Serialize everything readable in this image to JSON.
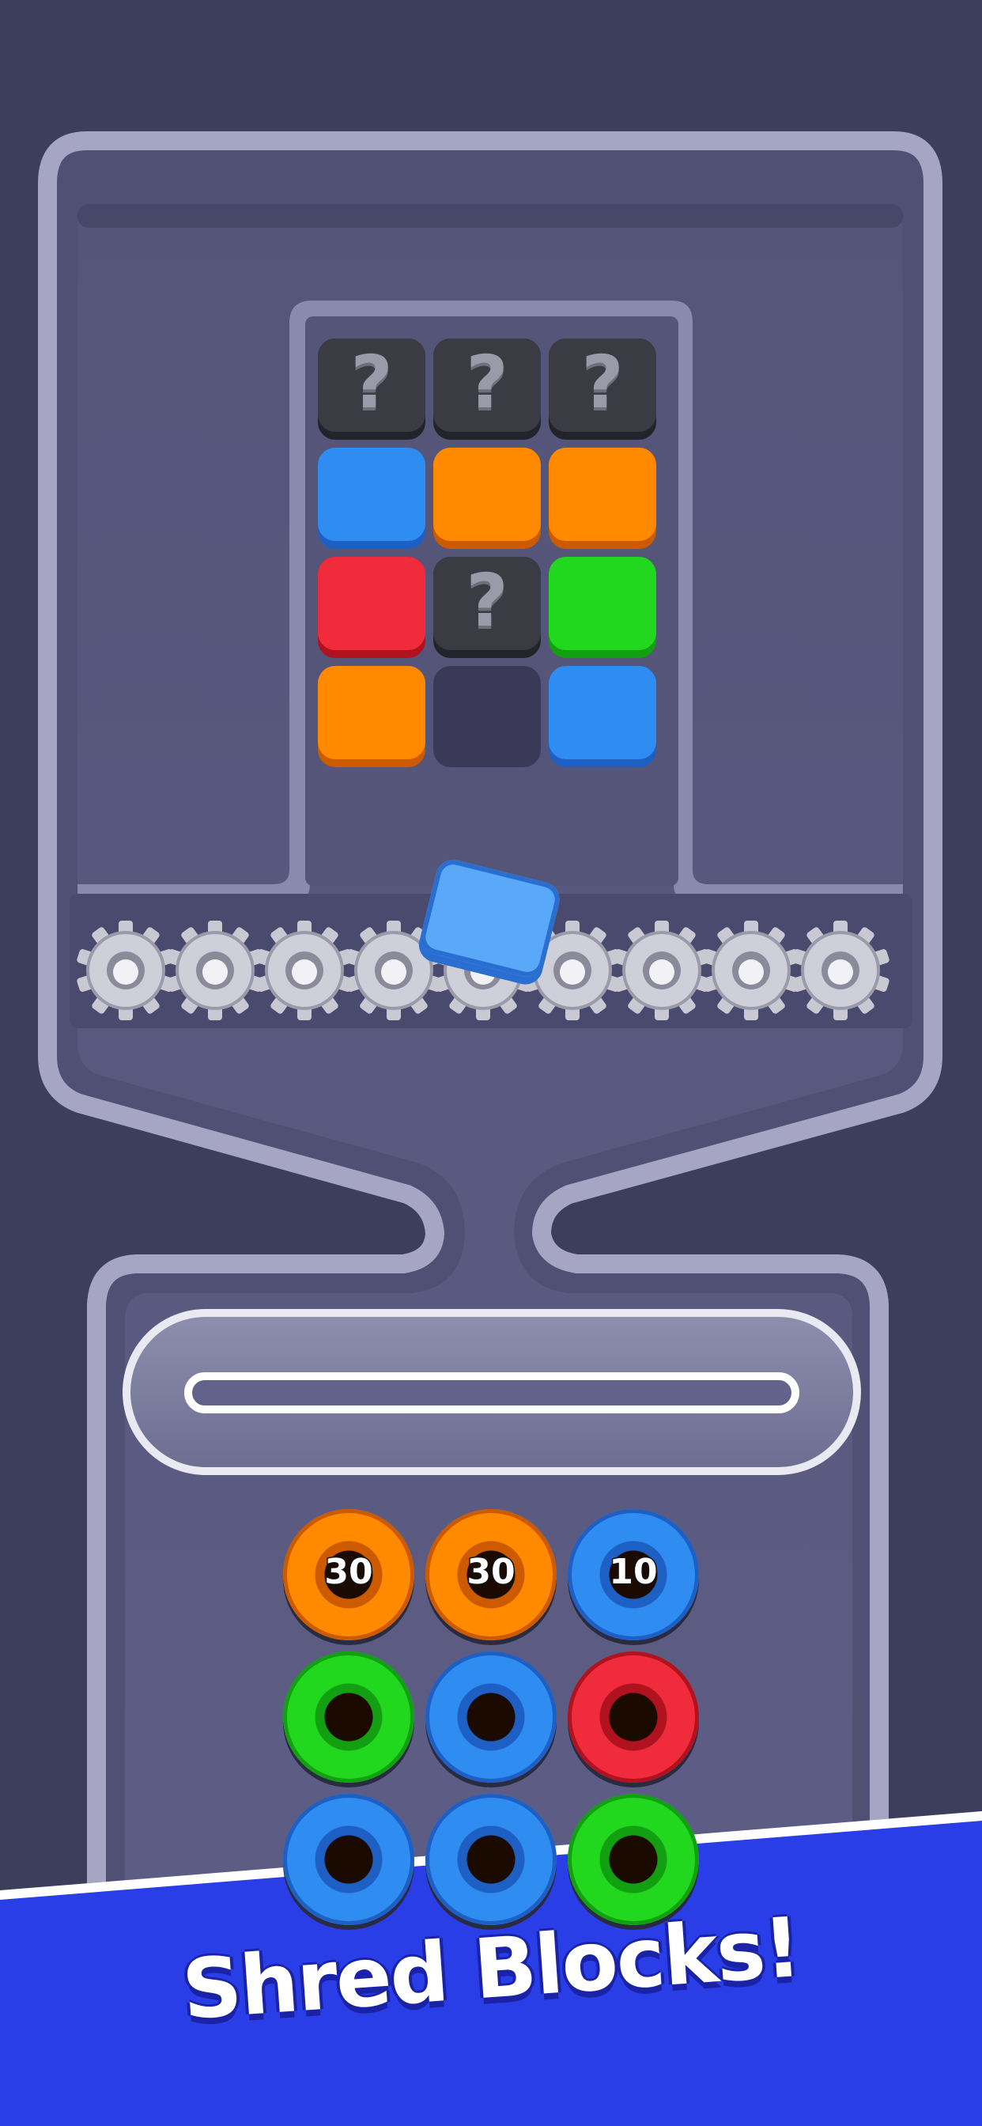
{
  "colors": {
    "background": "#3d3d5c",
    "board": "#5a5a82",
    "rail": "#a8a8c8",
    "blue": "#2f8cf0",
    "orange": "#ff8a00",
    "red": "#f02c3c",
    "green": "#22d81e",
    "mystery": "#3b3b44",
    "banner": "#2a3ee8"
  },
  "grid": {
    "columns": 3,
    "rows": [
      [
        {
          "type": "mystery",
          "label": "?"
        },
        {
          "type": "mystery",
          "label": "?"
        },
        {
          "type": "mystery",
          "label": "?"
        }
      ],
      [
        {
          "type": "block",
          "color": "blue"
        },
        {
          "type": "block",
          "color": "orange"
        },
        {
          "type": "block",
          "color": "orange"
        }
      ],
      [
        {
          "type": "block",
          "color": "red"
        },
        {
          "type": "mystery",
          "label": "?"
        },
        {
          "type": "block",
          "color": "green"
        }
      ],
      [
        {
          "type": "block",
          "color": "orange"
        },
        {
          "type": "empty"
        },
        {
          "type": "block",
          "color": "blue"
        }
      ]
    ]
  },
  "shredder": {
    "gear_count": 9,
    "active_block_color": "blue"
  },
  "coins": [
    {
      "color": "orange",
      "label": "30"
    },
    {
      "color": "orange",
      "label": "30"
    },
    {
      "color": "blue",
      "label": "10"
    },
    {
      "color": "green",
      "label": ""
    },
    {
      "color": "blue",
      "label": ""
    },
    {
      "color": "red",
      "label": ""
    },
    {
      "color": "blue",
      "label": ""
    },
    {
      "color": "blue",
      "label": ""
    },
    {
      "color": "green",
      "label": ""
    }
  ],
  "banner": {
    "text": "Shred Blocks!"
  }
}
